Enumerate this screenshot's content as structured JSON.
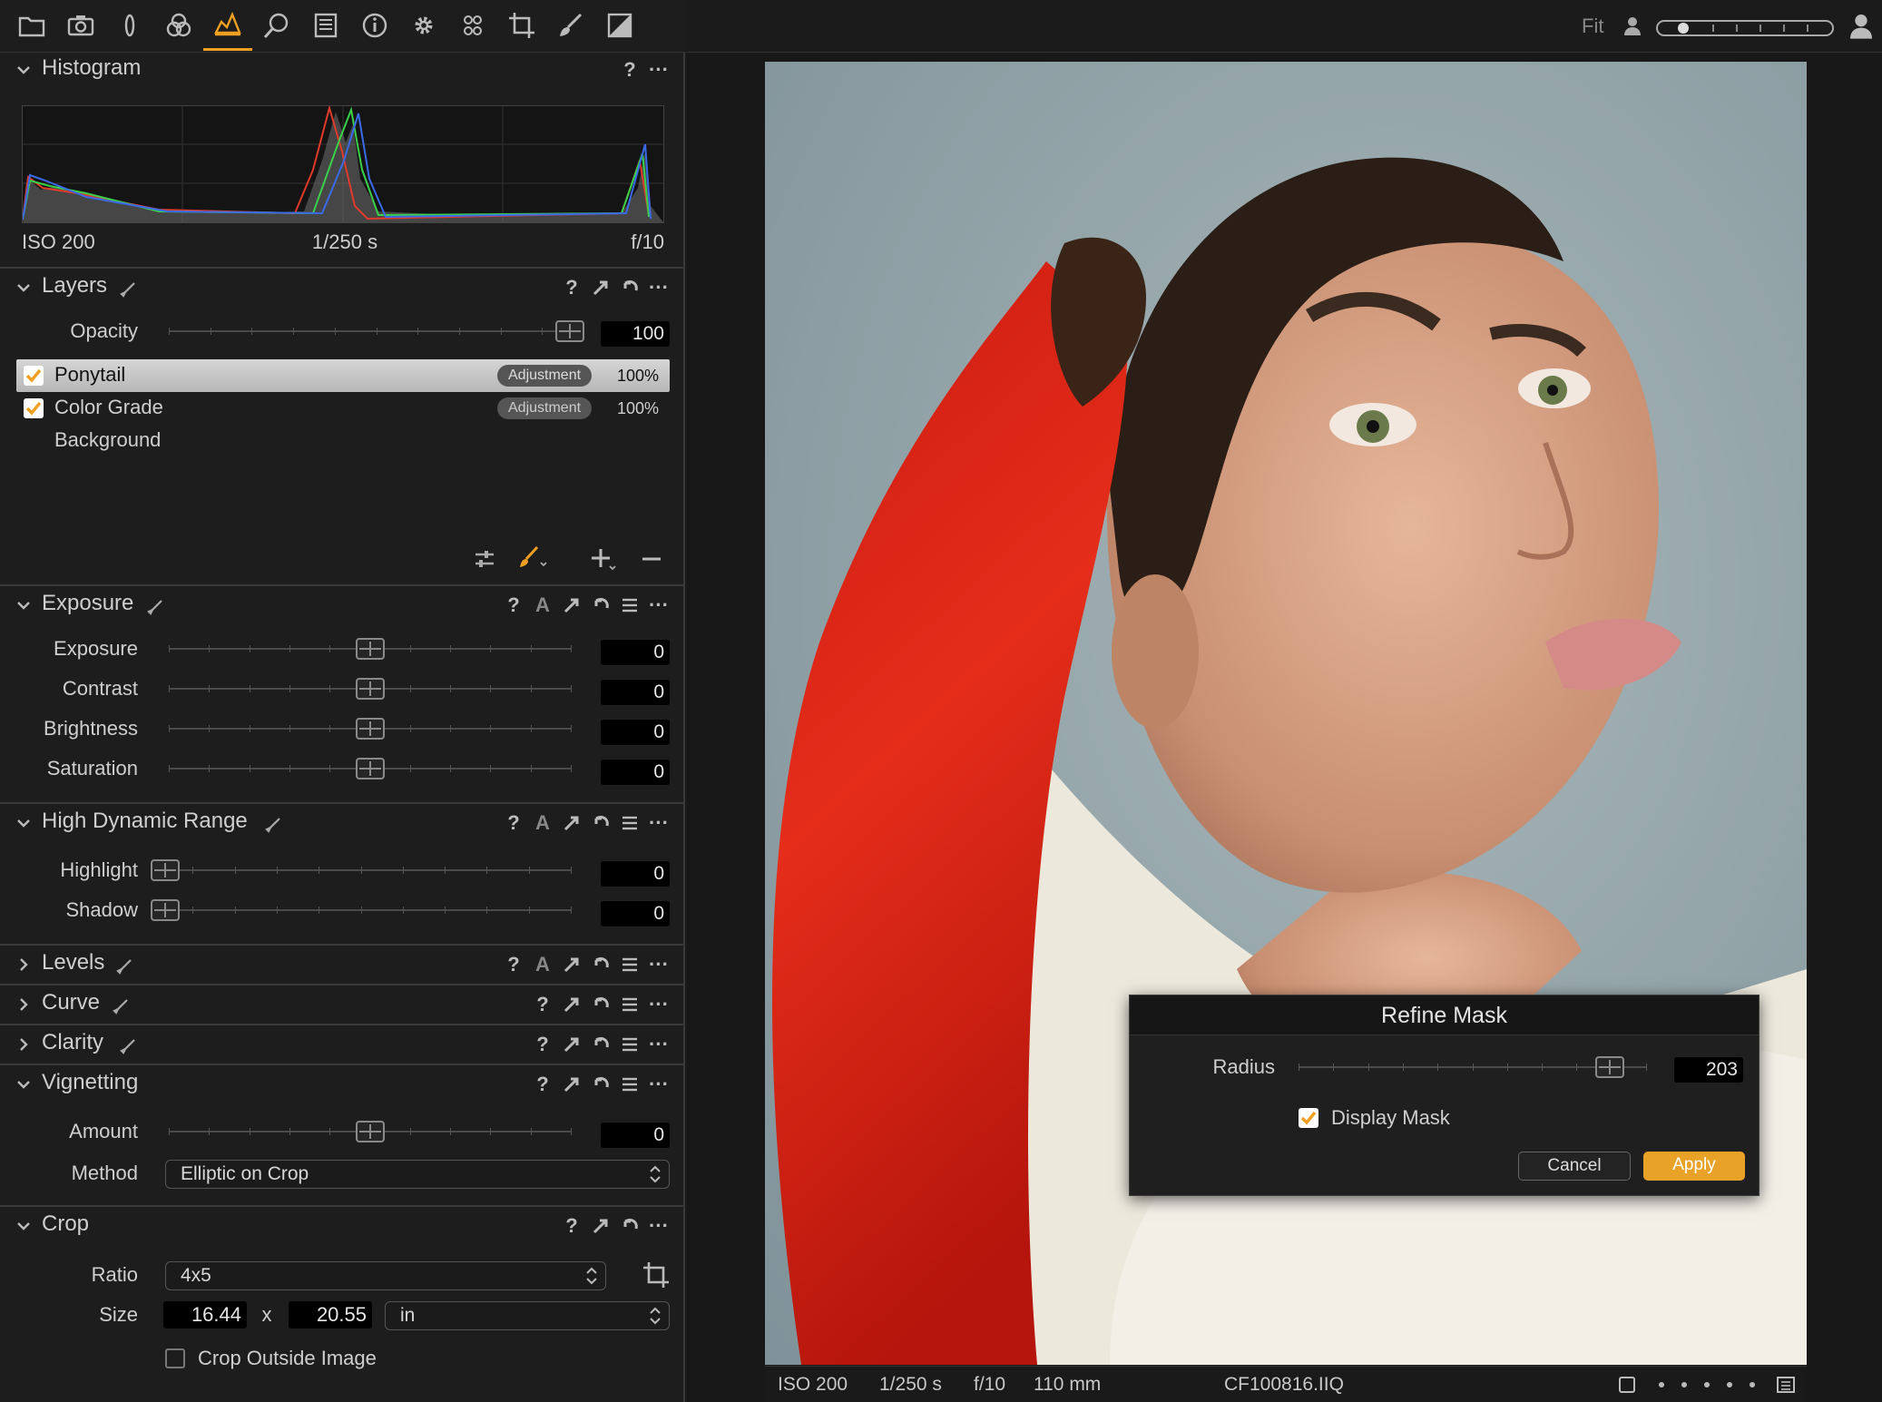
{
  "toolbar": {
    "icons": [
      "folder-icon",
      "camera-icon",
      "lens-icon",
      "color-icon",
      "exposure-icon",
      "details-icon",
      "metadata-icon",
      "info-icon",
      "gear-icon",
      "styles-icon",
      "crop-icon",
      "brush-icon",
      "mask-icon"
    ],
    "active": "exposure-icon"
  },
  "viewer_top": {
    "fit_label": "Fit"
  },
  "histogram": {
    "title": "Histogram",
    "iso": "ISO 200",
    "shutter": "1/250 s",
    "aperture": "f/10"
  },
  "layers": {
    "title": "Layers",
    "opacity_label": "Opacity",
    "opacity_value": "100",
    "opacity_level": 1.0,
    "items": [
      {
        "name": "Ponytail",
        "tag": "Adjustment",
        "pct": "100%",
        "checked": true,
        "selected": true
      },
      {
        "name": "Color Grade",
        "tag": "Adjustment",
        "pct": "100%",
        "checked": true,
        "selected": false
      },
      {
        "name": "Background",
        "tag": "",
        "pct": "",
        "checked": false,
        "selected": false
      }
    ]
  },
  "exposure": {
    "title": "Exposure",
    "rows": [
      {
        "label": "Exposure",
        "value": "0",
        "level": 0.5
      },
      {
        "label": "Contrast",
        "value": "0",
        "level": 0.5
      },
      {
        "label": "Brightness",
        "value": "0",
        "level": 0.5
      },
      {
        "label": "Saturation",
        "value": "0",
        "level": 0.5
      }
    ]
  },
  "hdr": {
    "title": "High Dynamic Range",
    "rows": [
      {
        "label": "Highlight",
        "value": "0",
        "level": 0.0
      },
      {
        "label": "Shadow",
        "value": "0",
        "level": 0.0
      }
    ]
  },
  "levels": {
    "title": "Levels"
  },
  "curve": {
    "title": "Curve"
  },
  "clarity": {
    "title": "Clarity"
  },
  "vignetting": {
    "title": "Vignetting",
    "amount_label": "Amount",
    "amount_value": "0",
    "amount_level": 0.5,
    "method_label": "Method",
    "method_value": "Elliptic on Crop"
  },
  "crop": {
    "title": "Crop",
    "ratio_label": "Ratio",
    "ratio_value": "4x5",
    "size_label": "Size",
    "width": "16.44",
    "x": "x",
    "height": "20.55",
    "unit": "in",
    "outside_label": "Crop Outside Image"
  },
  "status": {
    "iso": "ISO 200",
    "shutter": "1/250 s",
    "aperture": "f/10",
    "focal": "110 mm",
    "filename": "CF100816.IIQ"
  },
  "dialog": {
    "title": "Refine Mask",
    "radius_label": "Radius",
    "radius_value": "203",
    "radius_level": 0.93,
    "display_mask_label": "Display Mask",
    "cancel": "Cancel",
    "apply": "Apply"
  },
  "colors": {
    "accent": "#f0a020",
    "apply_bg": "#e8a228"
  }
}
